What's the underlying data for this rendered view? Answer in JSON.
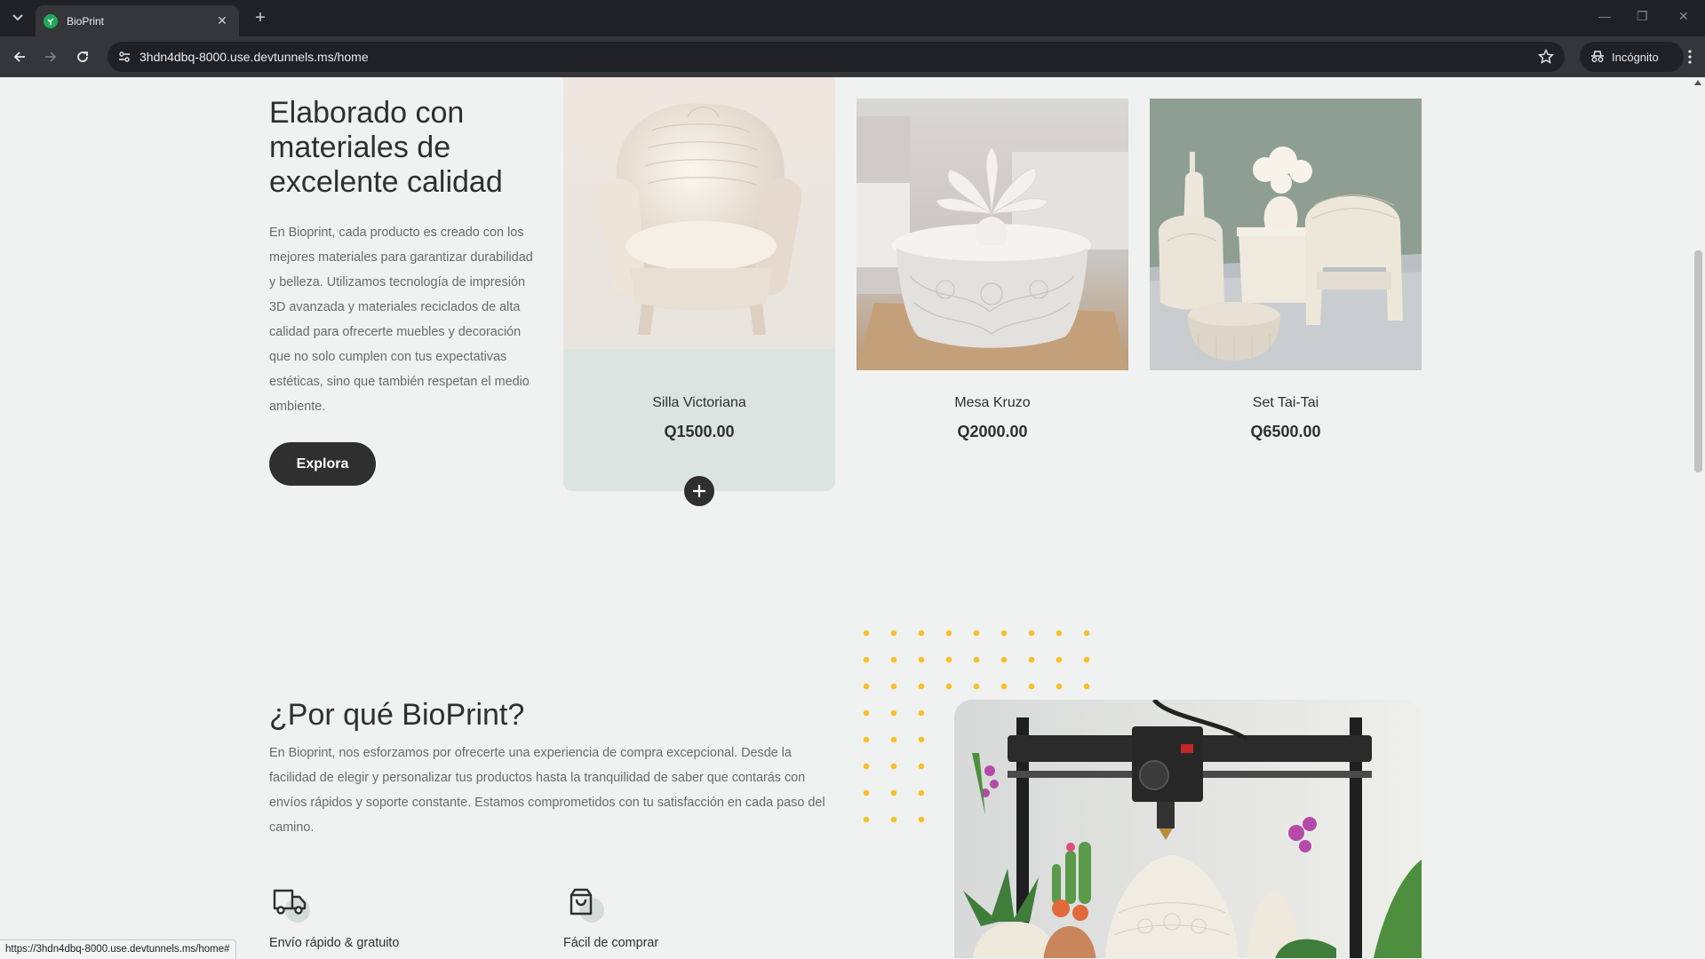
{
  "browser": {
    "tab_title": "BioPrint",
    "url": "3hdn4dbq-8000.use.devtunnels.ms/home",
    "incognito_label": "Incógnito",
    "status_url": "https://3hdn4dbq-8000.use.devtunnels.ms/home#"
  },
  "hero": {
    "heading": "Elaborado con materiales de excelente calidad",
    "text": "En Bioprint, cada producto es creado con los mejores materiales para garantizar durabilidad y belleza. Utilizamos tecnología de impresión 3D avanzada y materiales reciclados de alta calidad para ofrecerte muebles y decoración que no solo cumplen con tus expectativas estéticas, sino que también respetan el medio ambiente.",
    "button_label": "Explora"
  },
  "products": [
    {
      "name": "Silla Victoriana",
      "price": "Q1500.00"
    },
    {
      "name": "Mesa Kruzo",
      "price": "Q2000.00"
    },
    {
      "name": "Set Tai-Tai",
      "price": "Q6500.00"
    }
  ],
  "why": {
    "heading": "¿Por qué BioPrint?",
    "text": "En Bioprint, nos esforzamos por ofrecerte una experiencia de compra excepcional. Desde la facilidad de elegir y personalizar tus productos hasta la tranquilidad de saber que contarás con envíos rápidos y soporte constante. Estamos comprometidos con tu satisfacción en cada paso del camino.",
    "features": [
      {
        "title": "Envío rápido & gratuito",
        "icon": "truck-icon"
      },
      {
        "title": "Fácil de comprar",
        "icon": "bag-icon"
      }
    ]
  },
  "colors": {
    "background": "#eff2f1",
    "dark": "#2f2f2f",
    "card_active": "#dce4e2",
    "dot_accent": "#f9bf29"
  }
}
